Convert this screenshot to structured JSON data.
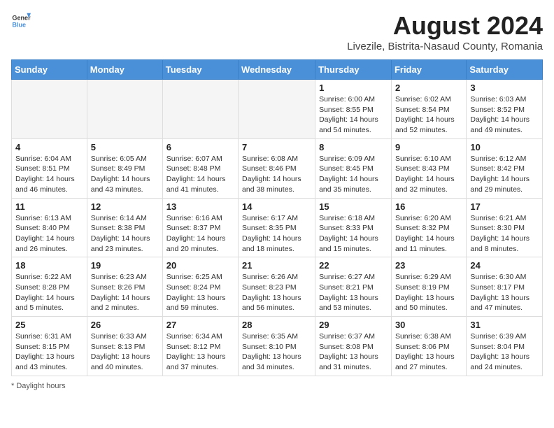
{
  "logo": {
    "text_general": "General",
    "text_blue": "Blue"
  },
  "header": {
    "month_year": "August 2024",
    "location": "Livezile, Bistrita-Nasaud County, Romania"
  },
  "weekdays": [
    "Sunday",
    "Monday",
    "Tuesday",
    "Wednesday",
    "Thursday",
    "Friday",
    "Saturday"
  ],
  "weeks": [
    [
      {
        "day": "",
        "info": ""
      },
      {
        "day": "",
        "info": ""
      },
      {
        "day": "",
        "info": ""
      },
      {
        "day": "",
        "info": ""
      },
      {
        "day": "1",
        "info": "Sunrise: 6:00 AM\nSunset: 8:55 PM\nDaylight: 14 hours and 54 minutes."
      },
      {
        "day": "2",
        "info": "Sunrise: 6:02 AM\nSunset: 8:54 PM\nDaylight: 14 hours and 52 minutes."
      },
      {
        "day": "3",
        "info": "Sunrise: 6:03 AM\nSunset: 8:52 PM\nDaylight: 14 hours and 49 minutes."
      }
    ],
    [
      {
        "day": "4",
        "info": "Sunrise: 6:04 AM\nSunset: 8:51 PM\nDaylight: 14 hours and 46 minutes."
      },
      {
        "day": "5",
        "info": "Sunrise: 6:05 AM\nSunset: 8:49 PM\nDaylight: 14 hours and 43 minutes."
      },
      {
        "day": "6",
        "info": "Sunrise: 6:07 AM\nSunset: 8:48 PM\nDaylight: 14 hours and 41 minutes."
      },
      {
        "day": "7",
        "info": "Sunrise: 6:08 AM\nSunset: 8:46 PM\nDaylight: 14 hours and 38 minutes."
      },
      {
        "day": "8",
        "info": "Sunrise: 6:09 AM\nSunset: 8:45 PM\nDaylight: 14 hours and 35 minutes."
      },
      {
        "day": "9",
        "info": "Sunrise: 6:10 AM\nSunset: 8:43 PM\nDaylight: 14 hours and 32 minutes."
      },
      {
        "day": "10",
        "info": "Sunrise: 6:12 AM\nSunset: 8:42 PM\nDaylight: 14 hours and 29 minutes."
      }
    ],
    [
      {
        "day": "11",
        "info": "Sunrise: 6:13 AM\nSunset: 8:40 PM\nDaylight: 14 hours and 26 minutes."
      },
      {
        "day": "12",
        "info": "Sunrise: 6:14 AM\nSunset: 8:38 PM\nDaylight: 14 hours and 23 minutes."
      },
      {
        "day": "13",
        "info": "Sunrise: 6:16 AM\nSunset: 8:37 PM\nDaylight: 14 hours and 20 minutes."
      },
      {
        "day": "14",
        "info": "Sunrise: 6:17 AM\nSunset: 8:35 PM\nDaylight: 14 hours and 18 minutes."
      },
      {
        "day": "15",
        "info": "Sunrise: 6:18 AM\nSunset: 8:33 PM\nDaylight: 14 hours and 15 minutes."
      },
      {
        "day": "16",
        "info": "Sunrise: 6:20 AM\nSunset: 8:32 PM\nDaylight: 14 hours and 11 minutes."
      },
      {
        "day": "17",
        "info": "Sunrise: 6:21 AM\nSunset: 8:30 PM\nDaylight: 14 hours and 8 minutes."
      }
    ],
    [
      {
        "day": "18",
        "info": "Sunrise: 6:22 AM\nSunset: 8:28 PM\nDaylight: 14 hours and 5 minutes."
      },
      {
        "day": "19",
        "info": "Sunrise: 6:23 AM\nSunset: 8:26 PM\nDaylight: 14 hours and 2 minutes."
      },
      {
        "day": "20",
        "info": "Sunrise: 6:25 AM\nSunset: 8:24 PM\nDaylight: 13 hours and 59 minutes."
      },
      {
        "day": "21",
        "info": "Sunrise: 6:26 AM\nSunset: 8:23 PM\nDaylight: 13 hours and 56 minutes."
      },
      {
        "day": "22",
        "info": "Sunrise: 6:27 AM\nSunset: 8:21 PM\nDaylight: 13 hours and 53 minutes."
      },
      {
        "day": "23",
        "info": "Sunrise: 6:29 AM\nSunset: 8:19 PM\nDaylight: 13 hours and 50 minutes."
      },
      {
        "day": "24",
        "info": "Sunrise: 6:30 AM\nSunset: 8:17 PM\nDaylight: 13 hours and 47 minutes."
      }
    ],
    [
      {
        "day": "25",
        "info": "Sunrise: 6:31 AM\nSunset: 8:15 PM\nDaylight: 13 hours and 43 minutes."
      },
      {
        "day": "26",
        "info": "Sunrise: 6:33 AM\nSunset: 8:13 PM\nDaylight: 13 hours and 40 minutes."
      },
      {
        "day": "27",
        "info": "Sunrise: 6:34 AM\nSunset: 8:12 PM\nDaylight: 13 hours and 37 minutes."
      },
      {
        "day": "28",
        "info": "Sunrise: 6:35 AM\nSunset: 8:10 PM\nDaylight: 13 hours and 34 minutes."
      },
      {
        "day": "29",
        "info": "Sunrise: 6:37 AM\nSunset: 8:08 PM\nDaylight: 13 hours and 31 minutes."
      },
      {
        "day": "30",
        "info": "Sunrise: 6:38 AM\nSunset: 8:06 PM\nDaylight: 13 hours and 27 minutes."
      },
      {
        "day": "31",
        "info": "Sunrise: 6:39 AM\nSunset: 8:04 PM\nDaylight: 13 hours and 24 minutes."
      }
    ]
  ],
  "footer": {
    "note": "Daylight hours"
  }
}
